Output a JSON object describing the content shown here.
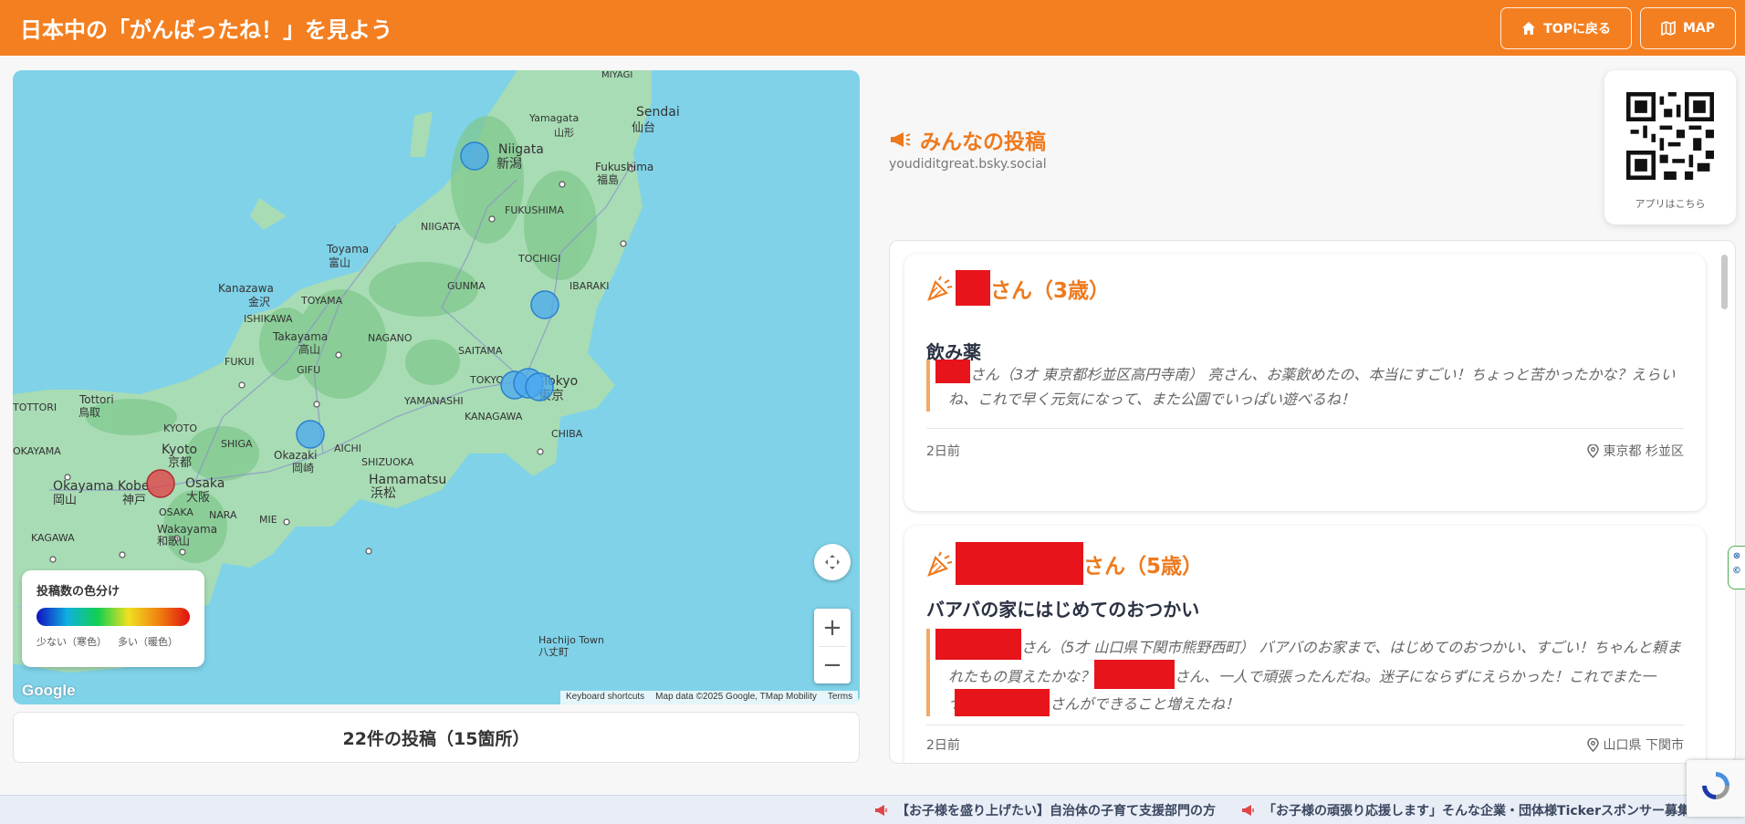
{
  "header": {
    "title": "日本中の「がんばったね！」を見よう",
    "top_button": "TOPに戻る",
    "map_button": "MAP"
  },
  "map": {
    "labels": {
      "miyagi": "MIYAGI",
      "sendai": "Sendai",
      "sendai_jp": "仙台",
      "yamagata": "Yamagata",
      "yamagata_jp": "山形",
      "niigata": "Niigata",
      "niigata_jp": "新潟",
      "fukushima": "Fukushima",
      "fukushima_jp": "福島",
      "fukushima_pref": "FUKUSHIMA",
      "niigata_pref": "NIIGATA",
      "tochigi": "TOCHIGI",
      "toyama": "Toyama",
      "toyama_jp": "富山",
      "kanazawa": "Kanazawa",
      "kanazawa_jp": "金沢",
      "toyama_pref": "TOYAMA",
      "gunma": "GUNMA",
      "ibaraki": "IBARAKI",
      "ishikawa": "ISHIKAWA",
      "takayama": "Takayama",
      "takayama_jp": "高山",
      "nagano": "NAGANO",
      "fukui": "FUKUI",
      "gifu": "GIFU",
      "saitama": "SAITAMA",
      "tokyo_pref": "TOKYO",
      "tokyo": "Tokyo",
      "tokyo_jp": "東京",
      "yamanashi": "YAMANASHI",
      "tottori_pref": "TOTTORI",
      "tottori": "Tottori",
      "tottori_jp": "鳥取",
      "kyoto_pref": "KYOTO",
      "shiga": "SHIGA",
      "kanagawa": "KANAGAWA",
      "chiba": "CHIBA",
      "okayama_pref": "OKAYAMA",
      "kyoto": "Kyoto",
      "kyoto_jp": "京都",
      "okazaki": "Okazaki",
      "okazaki_jp": "岡崎",
      "aichi": "AICHI",
      "shizuoka": "SHIZUOKA",
      "okayama": "Okayama",
      "okayama_jp": "岡山",
      "kobe": "Kobe",
      "kobe_jp": "神戸",
      "osaka": "Osaka",
      "osaka_jp": "大阪",
      "hamamatsu": "Hamamatsu",
      "hamamatsu_jp": "浜松",
      "osaka_pref": "OSAKA",
      "nara": "NARA",
      "mie": "MIE",
      "wakayama": "Wakayama",
      "wakayama_jp": "和歌山",
      "kagawa": "KAGAWA",
      "hachijo": "Hachijo Town",
      "hachijo_jp": "八丈町"
    },
    "legend": {
      "title": "投稿数の色分け",
      "low": "少ない（寒色）",
      "high": "多い（暖色）"
    },
    "google_logo": "Google",
    "attribution": {
      "shortcuts": "Keyboard shortcuts",
      "data": "Map data ©2025 Google, TMap Mobility",
      "terms": "Terms"
    },
    "zoom_in": "+",
    "zoom_out": "−"
  },
  "count_text": "22件の投稿（15箇所）",
  "feed": {
    "title": "みんなの投稿",
    "handle": "youdiditgreat.bsky.social",
    "posts": [
      {
        "name_suffix": "さん（3歳）",
        "heading": "飲み薬",
        "body": "さん（3才 東京都杉並区高円寺南） 亮さん、お薬飲めたの、本当にすごい！ちょっと苦かったかな？えらいね、これで早く元気になって、また公園でいっぱい遊べるね！",
        "time": "2日前",
        "location": "東京都 杉並区"
      },
      {
        "name_suffix": "さん（5歳）",
        "heading": "バアバの家にはじめてのおつかい",
        "body_a": "さん（5才 山口県下関市熊野西町） バアバのお家まで、はじめてのおつかい、すごい！ちゃんと頼まれたもの買えたかな？",
        "body_b": "さん、一人で頑張ったんだね。迷子にならずにえらかった！これでまた一つ、",
        "body_c": "さんができること増えたね！",
        "time": "2日前",
        "location": "山口県 下関市"
      }
    ]
  },
  "qr": {
    "caption": "アプリはこちら"
  },
  "ticker": {
    "item1": "【お子様を盛り上げたい】自治体の子育て支援部門の方",
    "item2": "「お子様の頑張り応援します」そんな企業・団体様Tickerスポンサー募集"
  },
  "colors": {
    "header": "#f47f20",
    "accent": "#ee7a1e",
    "sea": "#7fd2e8",
    "land": "#a8dcb4",
    "marker_blue": "#4aa8f0",
    "marker_red": "#e0454a",
    "redaction": "#e8141c"
  }
}
